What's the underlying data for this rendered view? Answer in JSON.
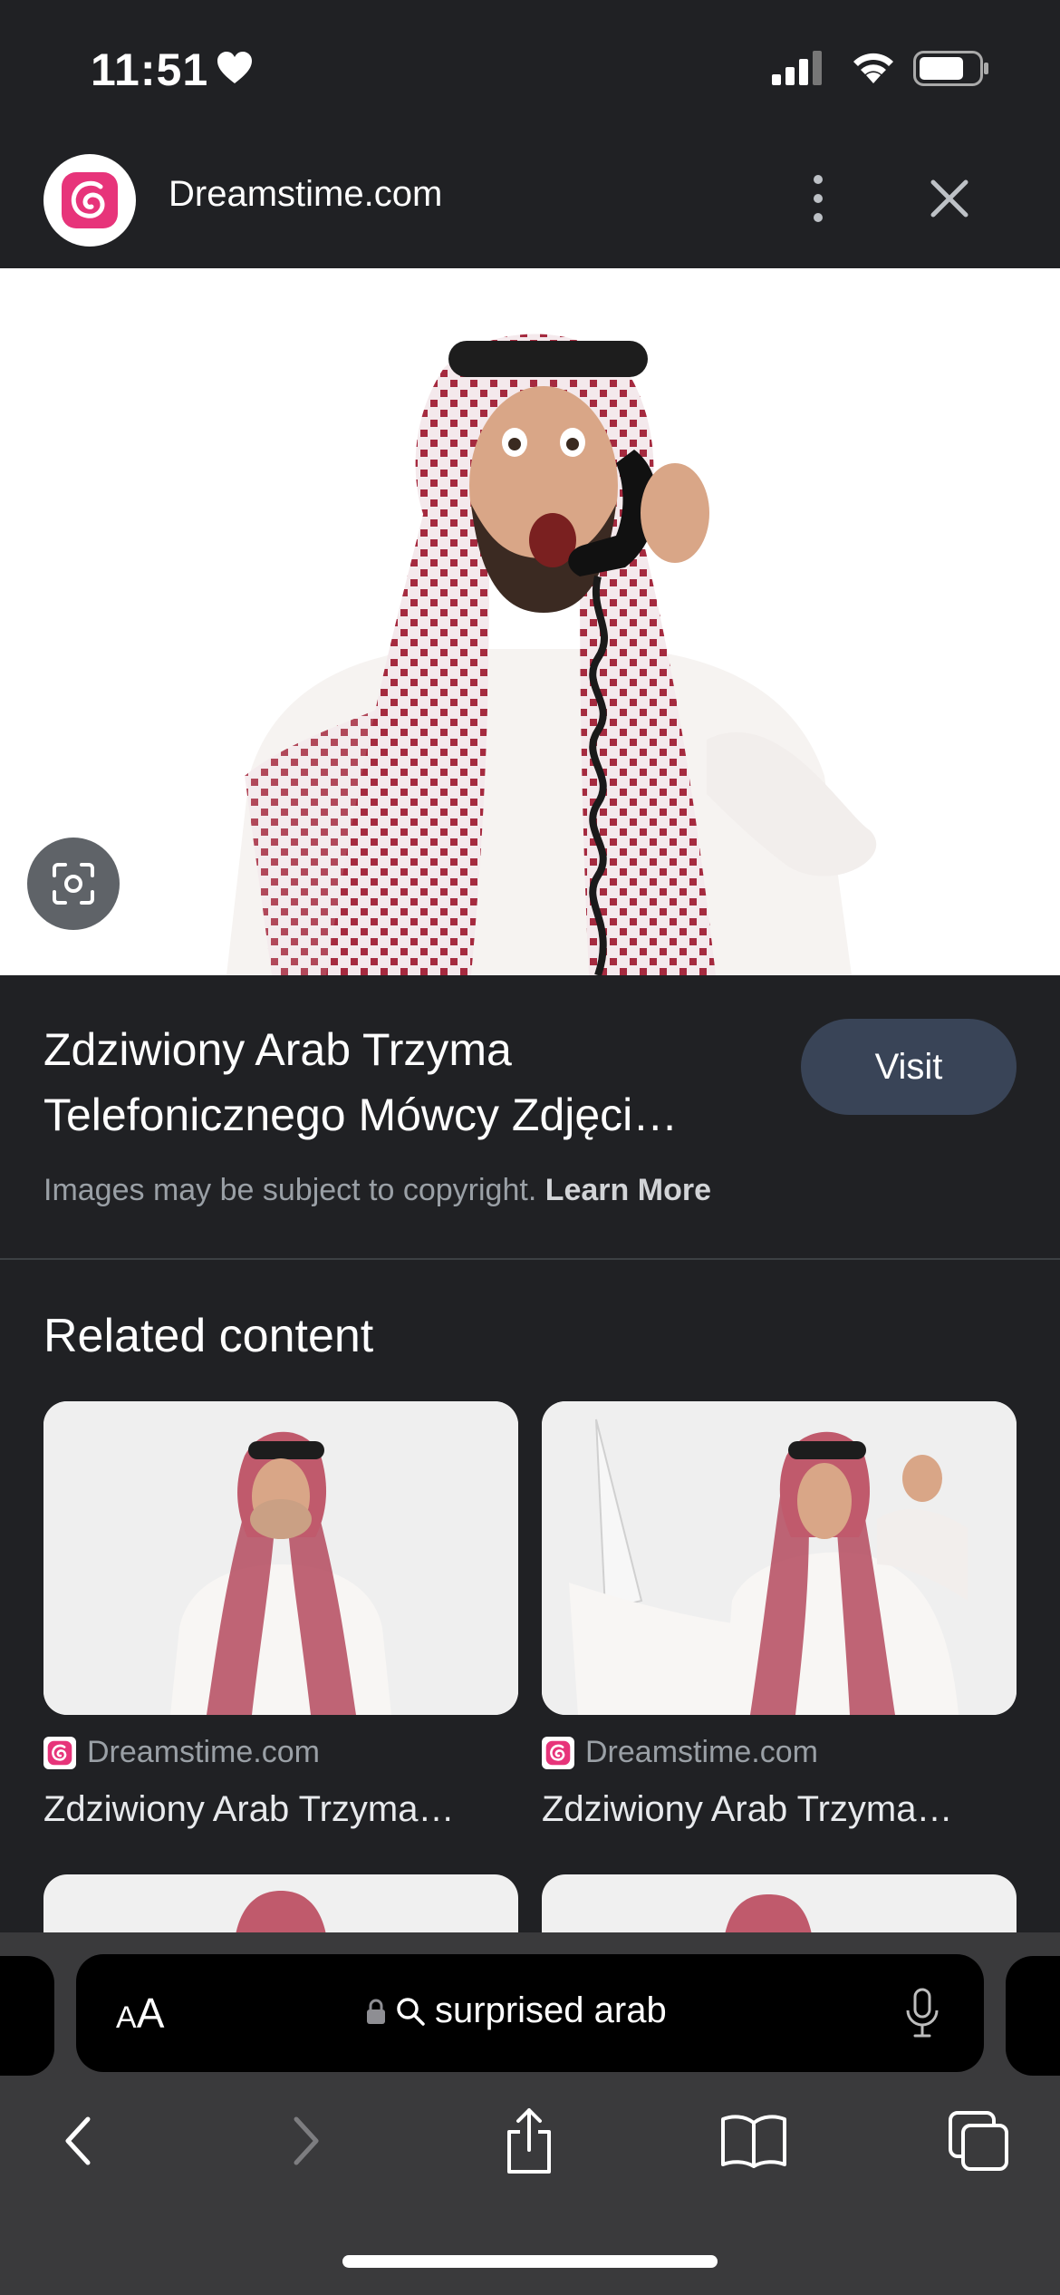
{
  "status_bar": {
    "time": "11:51"
  },
  "header": {
    "site_name": "Dreamstime.com"
  },
  "result": {
    "title_line1": "Zdziwiony Arab Trzyma",
    "title_line2": "Telefonicznego Mówcy Zdjęci…",
    "visit_label": "Visit",
    "copyright_text": "Images may be subject to copyright.",
    "learn_more_label": "Learn More"
  },
  "related": {
    "heading": "Related content",
    "cards": [
      {
        "source": "Dreamstime.com",
        "title": "Zdziwiony Arab Trzyma…"
      },
      {
        "source": "Dreamstime.com",
        "title": "Zdziwiony Arab Trzyma…"
      }
    ]
  },
  "toolbar": {
    "aa_label_small": "A",
    "aa_label_large": "A",
    "address_text": "surprised arab"
  },
  "colors": {
    "background": "#202124",
    "brand_pink": "#e7347a",
    "visit_button": "#394457",
    "toolbar": "#3a3a3c"
  },
  "icons": [
    "heart-icon",
    "signal-icon",
    "wifi-icon",
    "battery-icon",
    "more-icon",
    "close-icon",
    "lens-icon",
    "lock-icon",
    "search-icon",
    "mic-icon",
    "back-icon",
    "forward-icon",
    "share-icon",
    "bookmarks-icon",
    "tabs-icon"
  ]
}
